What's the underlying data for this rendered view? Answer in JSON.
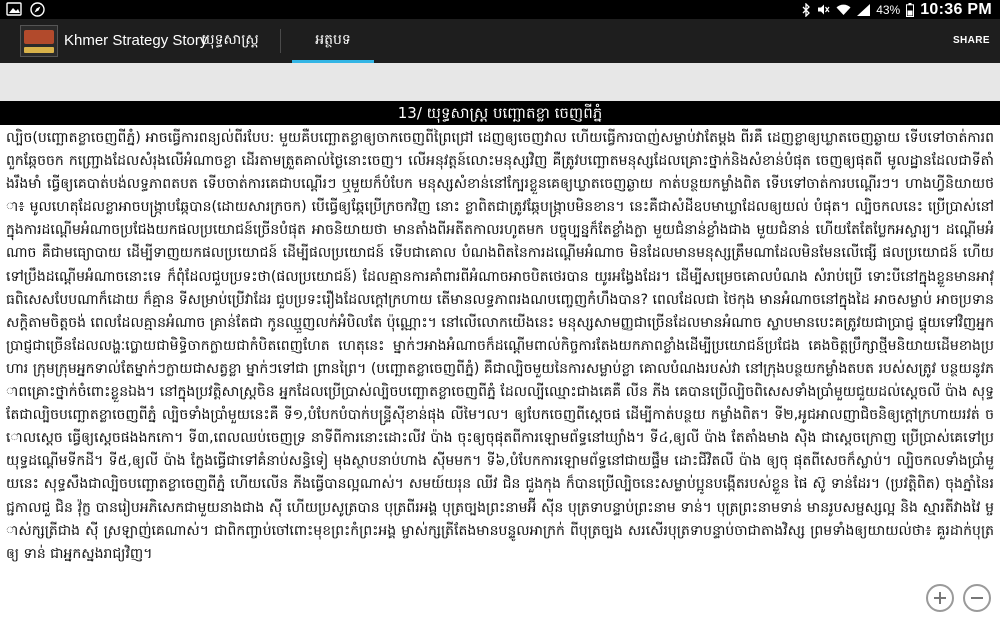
{
  "status_bar": {
    "battery_percent": "43%",
    "time": "10:36 PM",
    "icons": [
      "photo-icon",
      "compass-icon",
      "bluetooth-icon",
      "mute-icon",
      "wifi-icon",
      "signal-icon",
      "battery-icon"
    ]
  },
  "action_bar": {
    "app_title": "Khmer Strategy Story",
    "tabs": [
      {
        "label": "យុទ្ធសាស្ត្រ",
        "selected": false
      },
      {
        "label": "អត្ថបទ",
        "selected": true
      }
    ],
    "share_label": "SHARE",
    "accent_color": "#33b5e5"
  },
  "article": {
    "title": "13/ យុទ្ធសាស្ត្រ បញ្ឆោតខ្លា ចេញពីភ្នំ",
    "body": "ល្បិច(បញ្ឆោតខ្លាចេញពីភ្នំ) អាចធ្វើការពន្យល់ពីរបែប: មួយគឺបញ្ឆោតខ្លាឲ្យចាកចេញពីព្រៃជ្រៅ ដេញឲ្យចេញវាល ហើយធ្វើការបាញ់សម្លាប់វាតែម្តង ពីរគឺ ដេញខ្លាឲ្យឃ្លាតចេញឆ្ងាយ ទើបទៅចាត់ការពពួកឆ្កែចចក កញ្ជ្រោងដែលសំរុងលើអំណាចខ្លា ដើរតាមត្រួតគាល់ថ្ងៃនោះចេញ។ លើអនុវត្តន៍លោះមនុស្សវិញ គឺត្រូវបញ្ឆោតមនុស្សដែលគ្រោះថ្នាក់និងសំខាន់បំផុត ចេញឲ្យផុតពី មូលដ្ឋានដែលជាទីតាំងរឹងមាំ ធ្វើឲ្យគេបាត់បង់លទ្ធភាពតបត ទើបចាត់ការគេជាបណ្តើរៗ ឬមួយក៏បំបែក មនុស្សសំខាន់នៅក្បែរខ្លួនគេឲ្យឃ្លាតចេញឆ្ងាយ កាត់បន្ថយកម្លាំងពិត ទើបទៅចាត់ការបណ្តើរៗ។ ហាងហ្វីនិយាយថា៖ មូលហេតុដែលខ្លាអាចបង្ក្រាបឆ្កែបាន(ដោយសារក្រចក) បើធ្វើឲ្យឆ្កែប្រើក្រចកវិញ នោះ ខ្លាពិតជាត្រូវឆ្កែបង្ក្រាបមិនខាន។ នេះគឺជាសំដីឧបមាឃ្លាដែលឲ្យយល់ បំផុត។ ល្បិចកលនេះ ប្រើប្រាស់នៅក្នុងការដណ្តើមអំណាចប្រជែងយកផលប្រយោជន៍ច្រើនបំផុត អាចនិយាយថា មានតាំងពីអតីតកាលរហូតមក បច្ចុប្បន្នក៏តែខ្លាំងក្លា មួយជំនាន់ខ្លាំងជាង មួយជំនាន់ ហើយតែតែប្លែកអស្ចារ្យ។ ដណ្តើមអំណាច គឺជាមធ្យោបាយ ដើម្បីទាញយកផលប្រយោជន៍ ដើម្បីផលប្រយោជន៍ ទើបជាគោល បំណងពិតនៃការដណ្តើមអំណាច មិនដែលមានមនុស្សត្រឹមណាដែលមិនមែនលើផ្សើ ផលប្រយោជន៍ ហើយទៅប្រឹងដណ្តើមអំណាចនោះទេ ក៏ពុំដែលជួបប្រទះថា(ផលប្រយោជន៍) ដែលគ្មានការគាំពារពីអំណាចអាចបិតថេរបាន យូរអង្វែងដែរ។ ដើម្បីសម្រេចគោលបំណង សំរាប់ប្រើ ទោះបីនៅក្នុងខ្លួនមានអាវុធពិសេសបែបណាក៏ដោយ ក៏គ្មាន ទីសម្រាប់ប្រើវាដែរ ជួបប្រទះរឿងដែលក្តៅក្រហាយ តើមានលទ្ធភាពរងណបញ្ចេញកំហឹងបាន? ពេលដែលជា ថៃកុង មានអំណាចនៅក្នុងដៃ អាចសម្លាប់ អាចប្រទានសក្តិតាមចិត្តចង់ ពេលដែលគ្មានអំណាច គ្រាន់តែជា កូនឈ្មួញលក់អំបិលតែ ប៉ុណ្ណោះ។ នៅលើលោកយើងនេះ មនុស្សសាមញ្ញជាច្រើនដែលមានអំណាច ស្លាបមានបេះគត្រូវយជាប្រាជ្ញ ផ្ទុយទៅវិញអ្នកប្រាជ្ញជាច្រើនដែលលង្ហៈប្លោយជាមិទ្ធិចាកក្លាយជាកំបិតពេញហែត ហេតុនេះ ម្នាក់ៗអាងអំណាចក៏ដណ្តើមពាល់កិច្ចការតែងយកភាពខ្លាំងដើម្បីប្រយោជន៍ប្រជែង គេងចិត្តប្រឹក្សាថ្មីមនិយាយដើមខាងប្រហារ ក្រុមក្រុមអ្នកទាល់តែម្នាក់ៗក្លាយជាសត្វខ្លា ម្នាក់ៗទៅជា ព្រានព្រៃ។ (បញ្ឆោតខ្លាចេញពីភ្នំ) គឺជាល្បិចមួយនៃការសម្លាប់ខ្លា គោលបំណងរបស់វា នៅក្រុងបន្ថយកម្លាំងតបត របស់សត្រូវ បន្ថយនូវភាពគ្រោះថ្នាក់ចំពោះខ្លួនឯង។ នៅក្នុងប្រវត្តិសាស្ត្រចិន អ្នកដែលប្រើប្រាស់ល្បិចបញ្ឆោតខ្លាចេញពីភ្នំ ដែលល្បីឈ្មោះជាងគេគឺ លីន ភីង គេបានប្រើល្បិចពិសេសទាំងប្រាំមួយជួយដល់ស្តេចលី ប៉ាង សុទ្ធតែជាល្បិចបញ្ឆោតខ្លាចេញពីភ្នំ ល្បិចទាំងប្រាំមួយនេះគឺ ទី១,បំបែកបំបាក់បន្ទ្រីស៊ីខាន់ផុង លីមៃ។ល។ ឲ្យបែកចេញពីស្តេចផ ដើម្បីកាត់បន្ថយ កម្លាំងពិត។ ទី២,អូជអាលញាជិចនិឲ្យក្តៅក្រហាយរវត់ ចោលស្តេច ធ្វើឲ្យស្តេចផងងកកោ។ ទី៣,ពេលឈប់ចេញទ្រ នាទីពីការនោះដោះលីវ ប៉ាង ចុះឲ្យចុផុតពីការឡោមព័ទ្ធនៅឃ្យាំង។ ទី៤,ឲ្យលី ប៉ាង តែតាំងមាង ស៊ិង ជាស្តេចក្រោញ ប្រើប្រាស់គេទៅប្រយុទ្ធដណ្តើមទីកដី។ ទី៥,ឲ្យលី ប៉ាង ក្លែងធ្វើជាទៅគំនាប់សន្ធិទៀ មុងស្ថាបនាប់ហាង ស៊ីមមក។ ទី៦,បំបែកការឡោមព័ទ្ធនៅជាយផ្ទឹម ដោះជីវិតលី ប៉ាង ឲ្យចុ ផុតពីសេចក៏ស្លាប់។ ល្បិចកលទាំងប្រាំមួយនេះ សុទ្ធសឹងជាល្បិចបញ្ឆោតខ្លាចេញពីភ្នំ ហើយលើន ភីងធ្វើបានល្អណាស់។ សមយ៍យរុន ឈីវ ជិន ជួងកុង ក៏បានប្រើល្បិចនេះសម្លាប់ប្អូនបង្កើតរបស់ខ្លួន ផៃ ស៊ូ ទាន់ដែរ។ (ប្រវត្តិពិត) ចុងភ្នាំនៃរជ្ជកាលជួ ជិន វ៉ុក្ខ បានរៀបអភិសេកជាមួយនាងជាង ស៊ី ហើយប្រសូត្របាន បុត្រពីរអង្គ បុត្រច្បងព្រះនាមអ៊ី ស៊ីន បុត្រទាបន្ទាប់ព្រះនាម ទាន់។ បុត្រព្រះនាមទាន់ មានរូបសម្ផស្សល្អ និង ស្មារតីវាងវៃ ម្ចាស់ក្សត្រីជាង ស៊ី ស្រឡាញ់គេណាស់។ ជាពិកញ្ចាប់ចៅពោះមុខព្រះកំព្រះអង្គ ម្ចាស់ក្សត្រីតែងមានបន្ទូលអាក្រក់ ពីបុត្រច្បង សរសើរបុត្រទាបន្ទាប់ចាជាតាងវិស្ស ព្រមទាំងឲ្យយាយល់ថា៖ គួរដាក់បុត្រឲ្យ ទាន់ ជាអ្នកស្នងរាជ្យវិញ។"
  }
}
